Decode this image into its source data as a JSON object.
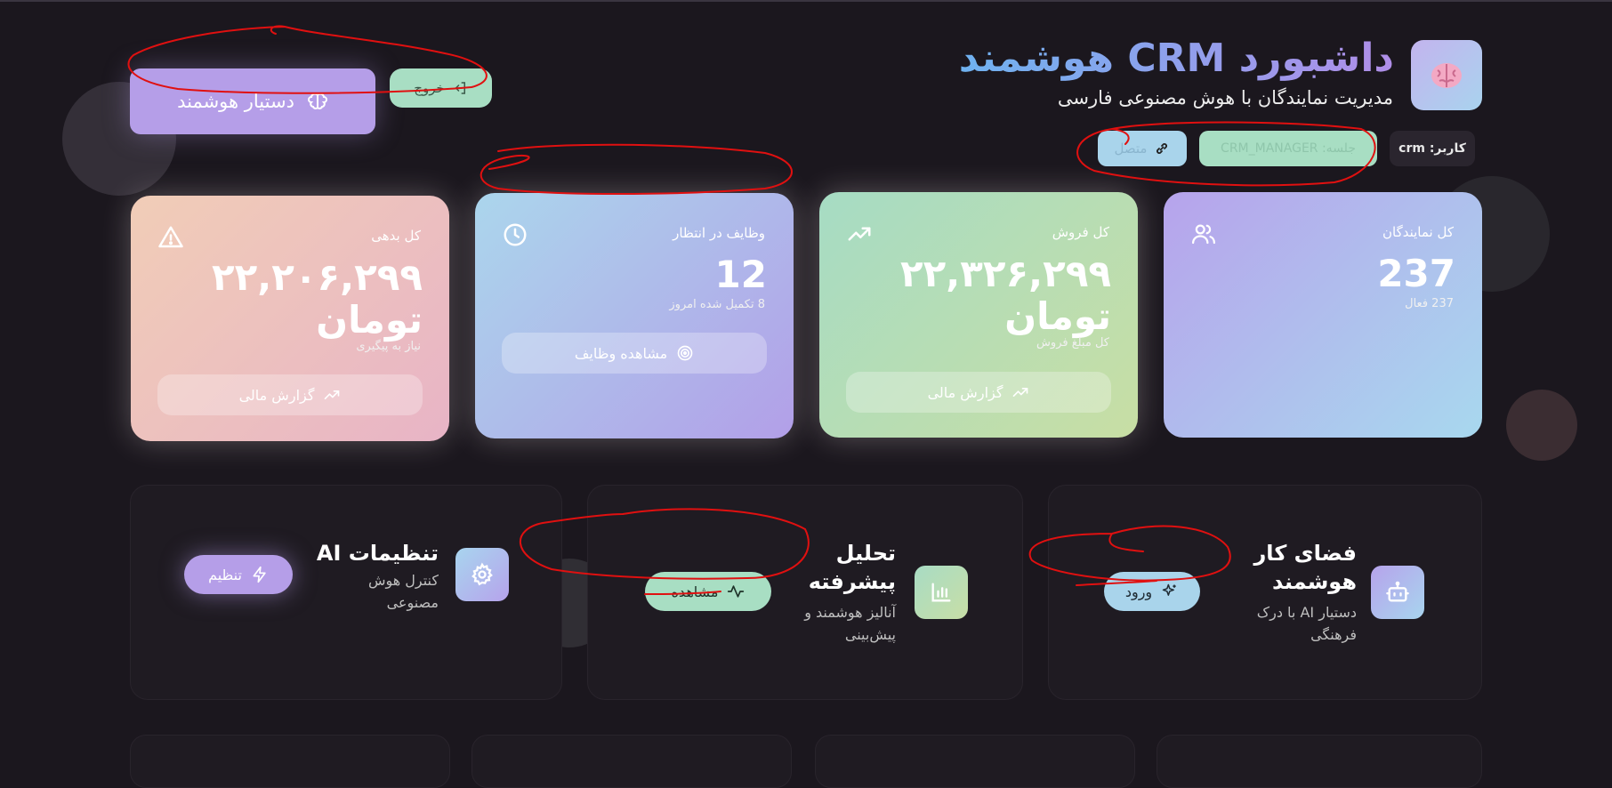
{
  "header": {
    "title": "داشبورد CRM هوشمند",
    "subtitle": "مدیریت نمایندگان با هوش مصنوعی فارسی",
    "user_label": "کاربر: crm",
    "session_label": "جلسه: CRM_MANAGER",
    "connection_label": "متصل",
    "ai_assistant_label": "دستیار هوشمند",
    "exit_label": "خروج"
  },
  "stats": [
    {
      "label": "کل نمایندگان",
      "value": "237",
      "sub": "237 فعال",
      "icon": "users-icon"
    },
    {
      "label": "کل فروش",
      "value": "۲۲,۳۲۶,۲۹۹",
      "unit": "تومان",
      "sub": "کل مبلغ فروش",
      "button": "گزارش مالی",
      "icon": "trending-up-icon"
    },
    {
      "label": "وظایف در انتظار",
      "value": "12",
      "sub": "8 تکمیل شده امروز",
      "button": "مشاهده وظایف",
      "icon": "clock-icon"
    },
    {
      "label": "کل بدهی",
      "value": "۲۲,۲۰۶,۲۹۹",
      "unit": "تومان",
      "sub": "نیاز به پیگیری",
      "button": "گزارش مالی",
      "icon": "alert-triangle-icon"
    }
  ],
  "features": [
    {
      "title": "فضای کار هوشمند",
      "desc": "دستیار AI با درک فرهنگی",
      "button": "ورود",
      "icon": "bot-icon"
    },
    {
      "title": "تحلیل پیشرفته",
      "desc": "آنالیز هوشمند و پیش‌بینی",
      "button": "مشاهده",
      "icon": "bar-chart-icon"
    },
    {
      "title": "تنظیمات AI",
      "desc": "کنترل هوش مصنوعی",
      "button": "تنظیم",
      "icon": "gear-icon"
    }
  ],
  "colors": {
    "background": "#1b171e",
    "lavender": "#b59ee8",
    "mint": "#a8dec3",
    "sky": "#a9d4eb",
    "annotation_red": "#e01010"
  }
}
